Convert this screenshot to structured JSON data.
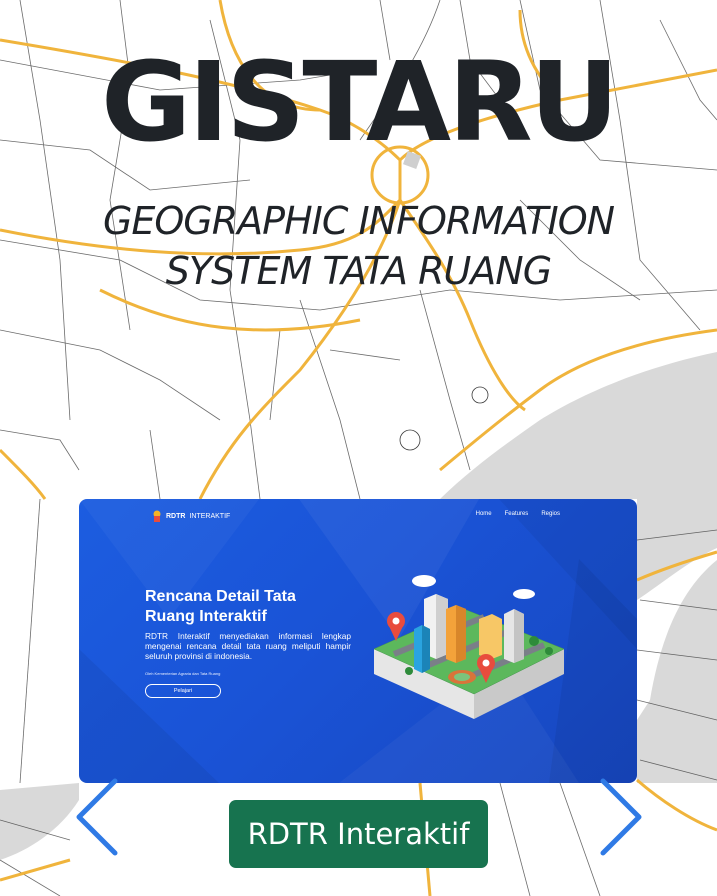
{
  "hero": {
    "title": "GISTARU",
    "subtitle_line1": "GEOGRAPHIC INFORMATION",
    "subtitle_line2": "SYSTEM TATA RUANG"
  },
  "carousel": {
    "active_caption": "RDTR Interaktif",
    "prev_icon": "chevron-left-icon",
    "next_icon": "chevron-right-icon",
    "accent_color": "#17734f",
    "slide": {
      "brand_bold": "RDTR",
      "brand_light": "INTERAKTIF",
      "menu": [
        "Home",
        "Features",
        "Regios"
      ],
      "heading_line1": "Rencana Detail Tata",
      "heading_line2": "Ruang Interaktif",
      "description": "RDTR Interaktif menyediakan informasi lengkap mengenai rencana detail tata ruang meliputi hampir seluruh provinsi di indonesia.",
      "credit": "Oleh Kementerian Agraria dan Tata Ruang",
      "button_label": "Pelajari"
    }
  },
  "colors": {
    "map_road": "#f0b43c",
    "map_street": "#3a3a3a",
    "map_water": "#d9d9d9",
    "slide_blue": "#1c5de0",
    "arrow_blue": "#2f7ae5"
  }
}
